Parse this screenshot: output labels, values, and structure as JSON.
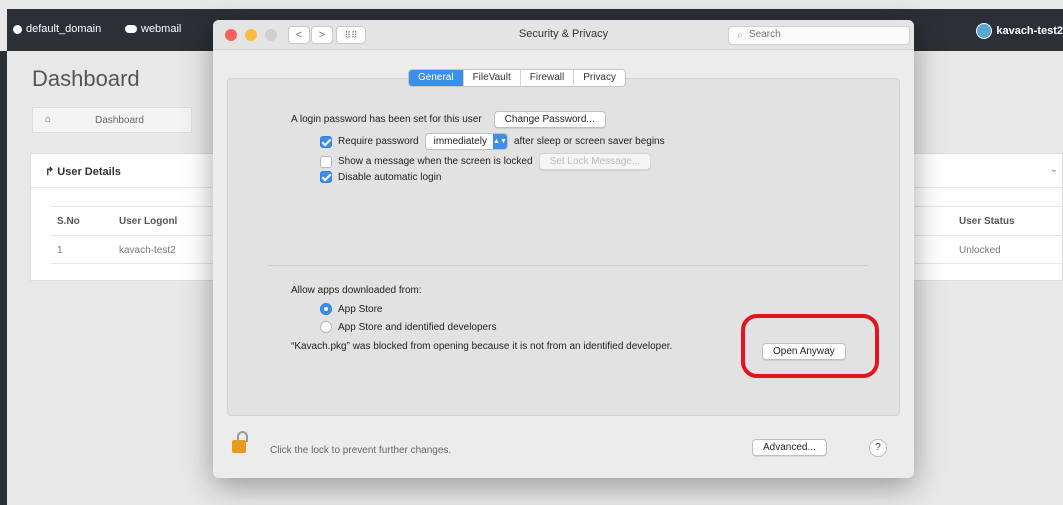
{
  "background": {
    "topbar": {
      "domain": "default_domain",
      "webmail": "webmail",
      "user": "kavach-test2"
    },
    "page_title": "Dashboard",
    "breadcrumb": "Dashboard",
    "panel_title": "User Details",
    "table": {
      "columns": [
        "S.No",
        "User Logonl",
        "User Status"
      ],
      "rows": [
        {
          "sno": "1",
          "logon": "kavach-test2",
          "status": "Unlocked"
        }
      ]
    }
  },
  "window": {
    "title": "Security & Privacy",
    "search_placeholder": "Search",
    "nav_back": "<",
    "nav_forward": ">",
    "grid": "⠿⠿",
    "tabs": [
      {
        "label": "General",
        "active": true
      },
      {
        "label": "FileVault",
        "active": false
      },
      {
        "label": "Firewall",
        "active": false
      },
      {
        "label": "Privacy",
        "active": false
      }
    ],
    "general": {
      "login_password_text": "A login password has been set for this user",
      "change_password_label": "Change Password...",
      "require_password_label": "Require password",
      "require_password_checked": true,
      "require_password_value": "immediately",
      "require_password_suffix": "after sleep or screen saver begins",
      "show_message_label": "Show a message when the screen is locked",
      "show_message_checked": false,
      "set_lock_message_label": "Set Lock Message...",
      "disable_auto_login_label": "Disable automatic login",
      "disable_auto_login_checked": true,
      "allow_apps_label": "Allow apps downloaded from:",
      "radio_app_store": "App Store",
      "radio_identified": "App Store and identified developers",
      "selected_radio": "App Store",
      "blocked_message": "“Kavach.pkg” was blocked from opening because it is not from an identified developer.",
      "open_anyway_label": "Open Anyway"
    },
    "footer": {
      "lock_text": "Click the lock to prevent further changes.",
      "advanced_label": "Advanced...",
      "help_label": "?"
    }
  },
  "colors": {
    "accent": "#3d8ee8",
    "annotation_red": "#e3141b",
    "lock_orange": "#e69a1e"
  }
}
